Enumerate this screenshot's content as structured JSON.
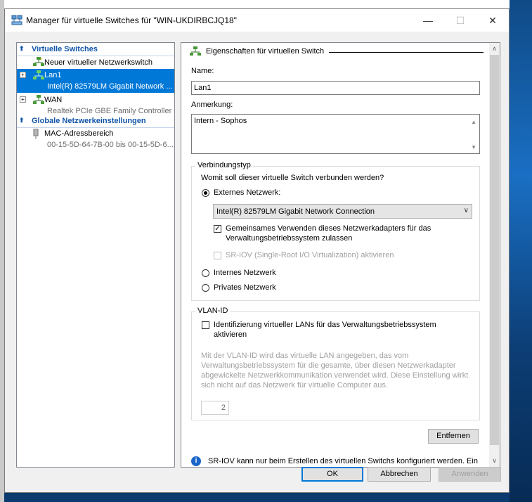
{
  "window": {
    "title": "Manager für virtuelle Switches für \"WIN-UKDIRBCJQ18\"",
    "minimize_glyph": "—",
    "maximize_glyph": "☐",
    "close_glyph": "✕"
  },
  "left": {
    "section_switches": "Virtuelle Switches",
    "new_switch": "Neuer virtueller Netzwerkswitch",
    "switches": [
      {
        "name": "Lan1",
        "adapter": "Intel(R) 82579LM Gigabit Network ..."
      },
      {
        "name": "WAN",
        "adapter": "Realtek PCIe GBE Family Controller"
      }
    ],
    "section_global": "Globale Netzwerkeinstellungen",
    "mac_title": "MAC-Adressbereich",
    "mac_range": "00-15-5D-64-7B-00 bis 00-15-5D-6..."
  },
  "props": {
    "header": "Eigenschaften für virtuellen Switch",
    "name_label": "Name:",
    "name_value": "Lan1",
    "note_label": "Anmerkung:",
    "note_value": "Intern - Sophos",
    "conn_group": "Verbindungstyp",
    "conn_question": "Womit soll dieser virtuelle Switch verbunden werden?",
    "external_label": "Externes Netzwerk:",
    "adapter_selected": "Intel(R) 82579LM Gigabit Network Connection",
    "share_line1": "Gemeinsames Verwenden dieses Netzwerkadapters für das",
    "share_line2": "Verwaltungsbetriebssystem zulassen",
    "sriov_label": "SR-IOV (Single-Root I/O Virtualization) aktivieren",
    "internal_label": "Internes Netzwerk",
    "private_label": "Privates Netzwerk",
    "vlan_group": "VLAN-ID",
    "vlan_check_line1": "Identifizierung virtueller LANs für das Verwaltungsbetriebssystem",
    "vlan_check_line2": "aktivieren",
    "vlan_desc": [
      "Mit der VLAN-ID wird das virtuelle LAN angegeben, das vom",
      "Verwaltungsbetriebssystem für die gesamte, über diesen Netzwerkadapter",
      "abgewickelte Netzwerkkommunikation verwendet wird. Diese Einstellung wirkt",
      "sich nicht auf das Netzwerk für virtuelle Computer aus."
    ],
    "vlan_value": "2",
    "remove_button": "Entfernen",
    "info_text": "SR-IOV kann nur beim Erstellen des virtuellen Switchs konfiguriert werden. Ein"
  },
  "footer": {
    "ok": "OK",
    "cancel": "Abbrechen",
    "apply": "Anwenden"
  },
  "colors": {
    "selection": "#0078d7",
    "section_header": "#1155aa"
  }
}
